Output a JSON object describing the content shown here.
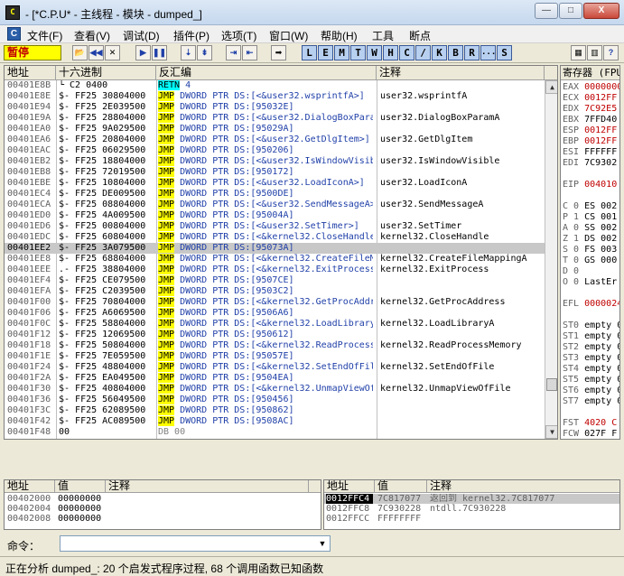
{
  "window": {
    "title": "- [*C.P.U* - 主线程 - 模块 - dumped_]",
    "app_icon": "C",
    "minimize": "—",
    "maximize": "□",
    "close": "X"
  },
  "menu": {
    "app_icon": "C",
    "items": [
      "文件(F)",
      "查看(V)",
      "调试(D)",
      "插件(P)",
      "选项(T)",
      "窗口(W)",
      "帮助(H)",
      "工具",
      "断点"
    ]
  },
  "toolbar": {
    "status": "暂停",
    "buttons": [
      "📂",
      "◀◀",
      "✕",
      "▶",
      "❚❚",
      "⇣",
      "⇟",
      "⇥",
      "⇤",
      "➡"
    ],
    "letters": [
      "L",
      "E",
      "M",
      "T",
      "W",
      "H",
      "C",
      "/",
      "K",
      "B",
      "R",
      "...",
      "S"
    ],
    "icons_right": [
      "▦",
      "▥",
      "?"
    ]
  },
  "cpu": {
    "headers": {
      "addr": "地址",
      "hex": "十六进制",
      "disasm": "反汇编",
      "comment": "注释"
    },
    "rows": [
      {
        "addr": "00401E8B",
        "hex": "└   C2 0400",
        "op": "RETN",
        "opclass": "retn",
        "arg": " 4",
        "comment": ""
      },
      {
        "addr": "00401E8E",
        "hex": "  $- FF25 30804000",
        "op": "JMP",
        "opclass": "jmp",
        "arg": " DWORD PTR DS:[<&user32.wsprintfA>]",
        "comment": "user32.wsprintfA"
      },
      {
        "addr": "00401E94",
        "hex": "  $- FF25 2E039500",
        "op": "JMP",
        "opclass": "jmp",
        "arg": " DWORD PTR DS:[95032E]",
        "comment": ""
      },
      {
        "addr": "00401E9A",
        "hex": "  $- FF25 28804000",
        "op": "JMP",
        "opclass": "jmp",
        "arg": " DWORD PTR DS:[<&user32.DialogBoxParamA>]",
        "comment": "user32.DialogBoxParamA"
      },
      {
        "addr": "00401EA0",
        "hex": "  $- FF25 9A029500",
        "op": "JMP",
        "opclass": "jmp",
        "arg": " DWORD PTR DS:[95029A]",
        "comment": ""
      },
      {
        "addr": "00401EA6",
        "hex": "  $- FF25 20804000",
        "op": "JMP",
        "opclass": "jmp",
        "arg": " DWORD PTR DS:[<&user32.GetDlgItem>]",
        "comment": "user32.GetDlgItem"
      },
      {
        "addr": "00401EAC",
        "hex": "  $- FF25 06029500",
        "op": "JMP",
        "opclass": "jmp",
        "arg": " DWORD PTR DS:[950206]",
        "comment": ""
      },
      {
        "addr": "00401EB2",
        "hex": "  $- FF25 18804000",
        "op": "JMP",
        "opclass": "jmp",
        "arg": " DWORD PTR DS:[<&user32.IsWindowVisible>]",
        "comment": "user32.IsWindowVisible"
      },
      {
        "addr": "00401EB8",
        "hex": "  $- FF25 72019500",
        "op": "JMP",
        "opclass": "jmp",
        "arg": " DWORD PTR DS:[950172]",
        "comment": ""
      },
      {
        "addr": "00401EBE",
        "hex": "  $- FF25 10804000",
        "op": "JMP",
        "opclass": "jmp",
        "arg": " DWORD PTR DS:[<&user32.LoadIconA>]",
        "comment": "user32.LoadIconA"
      },
      {
        "addr": "00401EC4",
        "hex": "  $- FF25 DE009500",
        "op": "JMP",
        "opclass": "jmp",
        "arg": " DWORD PTR DS:[9500DE]",
        "comment": ""
      },
      {
        "addr": "00401ECA",
        "hex": "  $- FF25 08804000",
        "op": "JMP",
        "opclass": "jmp",
        "arg": " DWORD PTR DS:[<&user32.SendMessageA>]",
        "comment": "user32.SendMessageA"
      },
      {
        "addr": "00401ED0",
        "hex": "  $- FF25 4A009500",
        "op": "JMP",
        "opclass": "jmp",
        "arg": " DWORD PTR DS:[95004A]",
        "comment": ""
      },
      {
        "addr": "00401ED6",
        "hex": "  $- FF25 00804000",
        "op": "JMP",
        "opclass": "jmp",
        "arg": " DWORD PTR DS:[<&user32.SetTimer>]",
        "comment": "user32.SetTimer"
      },
      {
        "addr": "00401EDC",
        "hex": "  $- FF25 60804000",
        "op": "JMP",
        "opclass": "jmp",
        "arg": " DWORD PTR DS:[<&kernel32.CloseHandle>]",
        "comment": "kernel32.CloseHandle"
      },
      {
        "addr": "00401EE2",
        "hex": "  $- FF25 3A079500",
        "op": "JMP",
        "opclass": "jmp",
        "arg": " DWORD PTR DS:[95073A]",
        "comment": "",
        "selected": true
      },
      {
        "addr": "00401EE8",
        "hex": "  $- FF25 68804000",
        "op": "JMP",
        "opclass": "jmp",
        "arg": " DWORD PTR DS:[<&kernel32.CreateFileMappingA>]",
        "comment": "kernel32.CreateFileMappingA"
      },
      {
        "addr": "00401EEE",
        "hex": "  .- FF25 38804000",
        "op": "JMP",
        "opclass": "jmp",
        "arg": " DWORD PTR DS:[<&kernel32.ExitProcess>]",
        "comment": "kernel32.ExitProcess"
      },
      {
        "addr": "00401EF4",
        "hex": "  $- FF25 CE079500",
        "op": "JMP",
        "opclass": "jmp",
        "arg": " DWORD PTR DS:[9507CE]",
        "comment": ""
      },
      {
        "addr": "00401EFA",
        "hex": "  $- FF25 C2039500",
        "op": "JMP",
        "opclass": "jmp",
        "arg": " DWORD PTR DS:[9503C2]",
        "comment": ""
      },
      {
        "addr": "00401F00",
        "hex": "  $- FF25 70804000",
        "op": "JMP",
        "opclass": "jmp",
        "arg": " DWORD PTR DS:[<&kernel32.GetProcAddress>]",
        "comment": "kernel32.GetProcAddress"
      },
      {
        "addr": "00401F06",
        "hex": "  $- FF25 A6069500",
        "op": "JMP",
        "opclass": "jmp",
        "arg": " DWORD PTR DS:[9506A6]",
        "comment": ""
      },
      {
        "addr": "00401F0C",
        "hex": "  $- FF25 58804000",
        "op": "JMP",
        "opclass": "jmp",
        "arg": " DWORD PTR DS:[<&kernel32.LoadLibraryA>]",
        "comment": "kernel32.LoadLibraryA"
      },
      {
        "addr": "00401F12",
        "hex": "  $- FF25 12069500",
        "op": "JMP",
        "opclass": "jmp",
        "arg": " DWORD PTR DS:[950612]",
        "comment": ""
      },
      {
        "addr": "00401F18",
        "hex": "  $- FF25 50804000",
        "op": "JMP",
        "opclass": "jmp",
        "arg": " DWORD PTR DS:[<&kernel32.ReadProcessMemory>]",
        "comment": "kernel32.ReadProcessMemory"
      },
      {
        "addr": "00401F1E",
        "hex": "  $- FF25 7E059500",
        "op": "JMP",
        "opclass": "jmp",
        "arg": " DWORD PTR DS:[95057E]",
        "comment": ""
      },
      {
        "addr": "00401F24",
        "hex": "  $- FF25 48804000",
        "op": "JMP",
        "opclass": "jmp",
        "arg": " DWORD PTR DS:[<&kernel32.SetEndOfFile>]",
        "comment": "kernel32.SetEndOfFile"
      },
      {
        "addr": "00401F2A",
        "hex": "  $- FF25 EA049500",
        "op": "JMP",
        "opclass": "jmp",
        "arg": " DWORD PTR DS:[9504EA]",
        "comment": ""
      },
      {
        "addr": "00401F30",
        "hex": "  $- FF25 40804000",
        "op": "JMP",
        "opclass": "jmp",
        "arg": " DWORD PTR DS:[<&kernel32.UnmapViewOfFile>]",
        "comment": "kernel32.UnmapViewOfFile"
      },
      {
        "addr": "00401F36",
        "hex": "  $- FF25 56049500",
        "op": "JMP",
        "opclass": "jmp",
        "arg": " DWORD PTR DS:[950456]",
        "comment": ""
      },
      {
        "addr": "00401F3C",
        "hex": "  $- FF25 62089500",
        "op": "JMP",
        "opclass": "jmp",
        "arg": " DWORD PTR DS:[950862]",
        "comment": ""
      },
      {
        "addr": "00401F42",
        "hex": "  $- FF25 AC089500",
        "op": "JMP",
        "opclass": "jmp",
        "arg": " DWORD PTR DS:[9508AC]",
        "comment": ""
      },
      {
        "addr": "00401F48",
        "hex": "     00",
        "op": "",
        "opclass": "",
        "arg": "DB 00",
        "comment": ""
      }
    ]
  },
  "registers": {
    "header": "寄存器 (FPU)",
    "lines": [
      {
        "name": "EAX ",
        "value": "0000000",
        "red": true
      },
      {
        "name": "ECX ",
        "value": "0012FF",
        "red": true
      },
      {
        "name": "EDX ",
        "value": "7C92E5",
        "red": true
      },
      {
        "name": "EBX ",
        "value": "7FFD40",
        "red": false
      },
      {
        "name": "ESP ",
        "value": "0012FF",
        "red": true
      },
      {
        "name": "EBP ",
        "value": "0012FF",
        "red": true
      },
      {
        "name": "ESI ",
        "value": "FFFFFF",
        "red": false
      },
      {
        "name": "EDI ",
        "value": "7C9302",
        "red": false
      },
      {
        "name": "",
        "value": "",
        "red": false
      },
      {
        "name": "EIP ",
        "value": "004010",
        "red": true
      },
      {
        "name": "",
        "value": "",
        "red": false
      },
      {
        "name": "C 0  ",
        "value": "ES 002",
        "red": false
      },
      {
        "name": "P 1  ",
        "value": "CS 001",
        "red": false
      },
      {
        "name": "A 0  ",
        "value": "SS 002",
        "red": false
      },
      {
        "name": "Z 1  ",
        "value": "DS 002",
        "red": false
      },
      {
        "name": "S 0  ",
        "value": "FS 003",
        "red": false
      },
      {
        "name": "T 0  ",
        "value": "GS 000",
        "red": false
      },
      {
        "name": "D 0",
        "value": "",
        "red": false
      },
      {
        "name": "O 0  ",
        "value": "LastEr",
        "red": false
      },
      {
        "name": "",
        "value": "",
        "red": false
      },
      {
        "name": "EFL ",
        "value": "0000024",
        "red": true
      },
      {
        "name": "",
        "value": "",
        "red": false
      },
      {
        "name": "ST0 ",
        "value": "empty 0",
        "red": false
      },
      {
        "name": "ST1 ",
        "value": "empty 0",
        "red": false
      },
      {
        "name": "ST2 ",
        "value": "empty 0",
        "red": false
      },
      {
        "name": "ST3 ",
        "value": "empty 0",
        "red": false
      },
      {
        "name": "ST4 ",
        "value": "empty 0",
        "red": false
      },
      {
        "name": "ST5 ",
        "value": "empty 0",
        "red": false
      },
      {
        "name": "ST6 ",
        "value": "empty 0",
        "red": false
      },
      {
        "name": "ST7 ",
        "value": "empty 0",
        "red": false
      },
      {
        "name": "",
        "value": "",
        "red": false
      },
      {
        "name": "FST ",
        "value": "4020  C",
        "red": true
      },
      {
        "name": "FCW ",
        "value": "027F  F",
        "red": false
      }
    ]
  },
  "dump": {
    "headers": {
      "addr": "地址",
      "value": "值",
      "comment": "注释"
    },
    "rows": [
      {
        "addr": "00402000",
        "value": "00000000",
        "comment": ""
      },
      {
        "addr": "00402004",
        "value": "00000000",
        "comment": ""
      },
      {
        "addr": "00402008",
        "value": "00000000",
        "comment": ""
      }
    ]
  },
  "stack": {
    "headers": {
      "addr": "地址",
      "value": "值",
      "comment": "注释"
    },
    "rows": [
      {
        "addr": "0012FFC4",
        "value": "7C817077",
        "comment": "返回到 kernel32.7C817077",
        "selected": true
      },
      {
        "addr": "0012FFC8",
        "value": "7C930228",
        "comment": "ntdll.7C930228"
      },
      {
        "addr": "0012FFCC",
        "value": "FFFFFFFF",
        "comment": ""
      }
    ]
  },
  "command": {
    "label": "命令：",
    "value": ""
  },
  "status": {
    "text": "正在分析 dumped_: 20 个启发式程序过程, 68 个调用函数已知函数"
  }
}
